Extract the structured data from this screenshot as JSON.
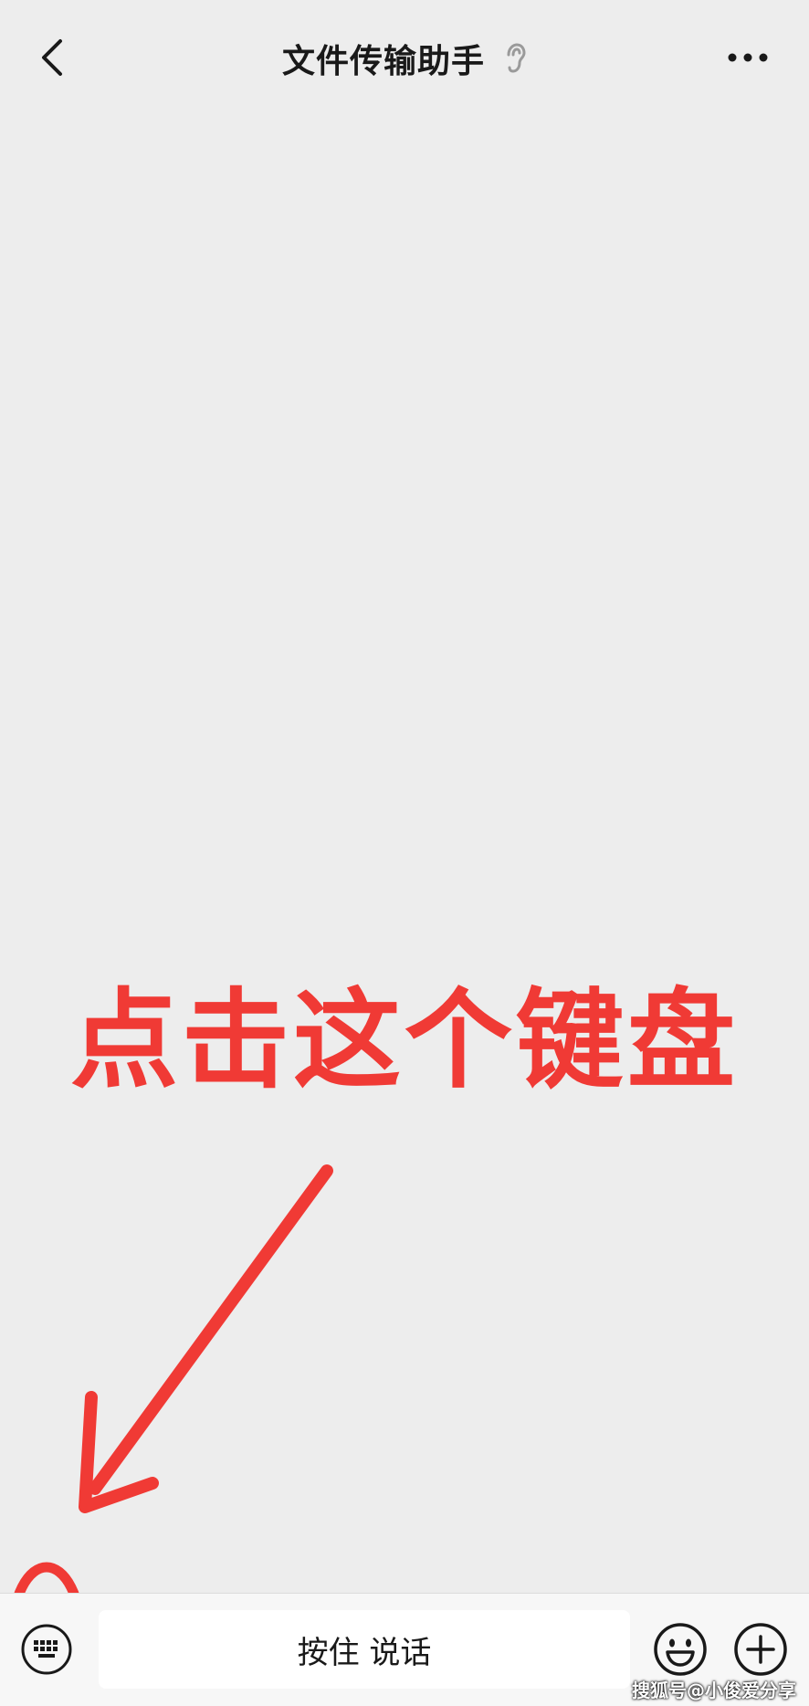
{
  "header": {
    "title": "文件传输助手",
    "back_icon": "chevron-left-icon",
    "ear_icon": "ear-icon",
    "more_icon": "more-icon"
  },
  "annotation": {
    "text": "点击这个键盘",
    "color": "#f03a35"
  },
  "input_bar": {
    "keyboard_icon": "keyboard-icon",
    "hold_to_talk_label": "按住 说话",
    "emoji_icon": "emoji-icon",
    "plus_icon": "plus-icon"
  },
  "watermark": {
    "text": "搜狐号@小俊爱分享"
  },
  "colors": {
    "background": "#ededed",
    "bottom_bar": "#f7f7f7",
    "annotation_red": "#f03a35"
  }
}
